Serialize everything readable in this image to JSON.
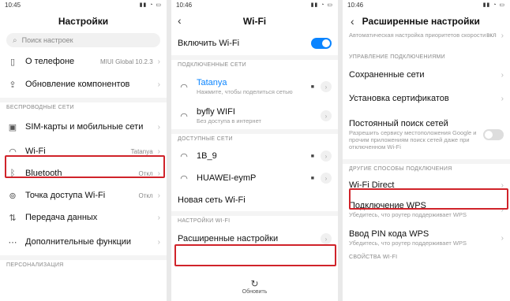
{
  "panel1": {
    "time": "10:45",
    "title": "Настройки",
    "search_placeholder": "Поиск настроек",
    "about": {
      "label": "О телефоне",
      "value": "MIUI Global 10.2.3"
    },
    "update": {
      "label": "Обновление компонентов"
    },
    "cat_wireless": "БЕСПРОВОДНЫЕ СЕТИ",
    "sim": {
      "label": "SIM-карты и мобильные сети"
    },
    "wifi": {
      "label": "Wi-Fi",
      "value": "Tatanya"
    },
    "bluetooth": {
      "label": "Bluetooth",
      "value": "Откл"
    },
    "hotspot": {
      "label": "Точка доступа Wi-Fi",
      "value": "Откл"
    },
    "data": {
      "label": "Передача данных"
    },
    "extra": {
      "label": "Дополнительные функции"
    },
    "cat_personal": "ПЕРСОНАЛИЗАЦИЯ"
  },
  "panel2": {
    "time": "10:46",
    "title": "Wi-Fi",
    "enable_label": "Включить Wi-Fi",
    "cat_connected": "ПОДКЛЮЧЕННЫЕ СЕТИ",
    "net1": {
      "name": "Tatanya",
      "sub": "Нажмите, чтобы поделиться сетью"
    },
    "net2": {
      "name": "byfly WIFI",
      "sub": "Без доступа в интернет"
    },
    "cat_available": "ДОСТУПНЫЕ СЕТИ",
    "net3": {
      "name": "1B_9"
    },
    "net4": {
      "name": "HUAWEI-eymP"
    },
    "new_net": "Новая сеть Wi-Fi",
    "cat_settings": "НАСТРОЙКИ WI-FI",
    "advanced": "Расширенные настройки",
    "refresh": "Обновить"
  },
  "panel3": {
    "time": "10:46",
    "title": "Расширенные настройки",
    "top_sub": "Автоматическая настройка приоритетов скорости",
    "top_val": "вкл",
    "cat_manage": "УПРАВЛЕНИЕ ПОДКЛЮЧЕНИЯМИ",
    "saved": "Сохраненные сети",
    "certs": "Установка сертификатов",
    "scan": {
      "label": "Постоянный поиск сетей",
      "sub": "Разрешить сервису местоположения Google и прочим приложениям поиск сетей даже при отключенном Wi-Fi"
    },
    "cat_other": "ДРУГИЕ СПОСОБЫ ПОДКЛЮЧЕНИЯ",
    "direct": "Wi-Fi Direct",
    "wps": {
      "label": "Подключение WPS",
      "sub": "Убедитесь, что роутер поддерживает WPS"
    },
    "pin": {
      "label": "Ввод PIN кода WPS",
      "sub": "Убедитесь, что роутер поддерживает WPS"
    },
    "cat_props": "СВОЙСТВА WI-FI"
  }
}
